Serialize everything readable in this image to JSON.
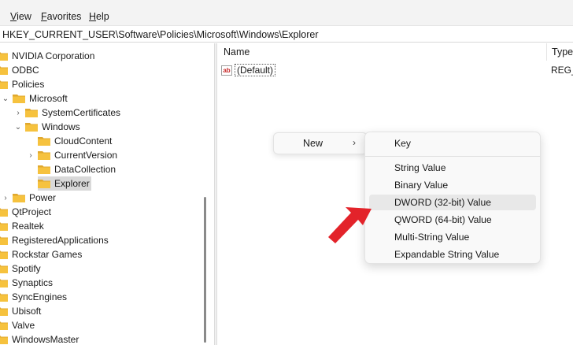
{
  "menu": {
    "view": "iew",
    "view_key": "V",
    "favorites": "avorites",
    "favorites_key": "F",
    "help": "elp",
    "help_key": "H"
  },
  "address": {
    "path": "HKEY_CURRENT_USER\\Software\\Policies\\Microsoft\\Windows\\Explorer"
  },
  "tree": {
    "items": [
      {
        "label": "NVIDIA Corporation"
      },
      {
        "label": "ODBC"
      },
      {
        "label": "Policies"
      },
      {
        "label": "Microsoft"
      },
      {
        "label": "SystemCertificates"
      },
      {
        "label": "Windows"
      },
      {
        "label": "CloudContent"
      },
      {
        "label": "CurrentVersion"
      },
      {
        "label": "DataCollection"
      },
      {
        "label": "Explorer"
      },
      {
        "label": "Power"
      },
      {
        "label": "QtProject"
      },
      {
        "label": "Realtek"
      },
      {
        "label": "RegisteredApplications"
      },
      {
        "label": "Rockstar Games"
      },
      {
        "label": "Spotify"
      },
      {
        "label": "Synaptics"
      },
      {
        "label": "SyncEngines"
      },
      {
        "label": "Ubisoft"
      },
      {
        "label": "Valve"
      },
      {
        "label": "WindowsMaster"
      }
    ],
    "selected": "Explorer"
  },
  "list": {
    "columns": {
      "name": "Name",
      "type": "Type"
    },
    "rows": [
      {
        "name": "(Default)",
        "type": "REG_",
        "icon": "ab"
      }
    ]
  },
  "context_menu": {
    "new_label": "New",
    "arrow": "›"
  },
  "submenu": {
    "items": [
      {
        "label": "Key"
      },
      {
        "label": "String Value"
      },
      {
        "label": "Binary Value"
      },
      {
        "label": "DWORD (32-bit) Value"
      },
      {
        "label": "QWORD (64-bit) Value"
      },
      {
        "label": "Multi-String Value"
      },
      {
        "label": "Expandable String Value"
      }
    ],
    "highlighted": "DWORD (32-bit) Value"
  },
  "colors": {
    "folder": "#f6c23e",
    "folder_dark": "#e0a82e",
    "arrow": "#e3232a",
    "selected": "#d9d9d9"
  }
}
